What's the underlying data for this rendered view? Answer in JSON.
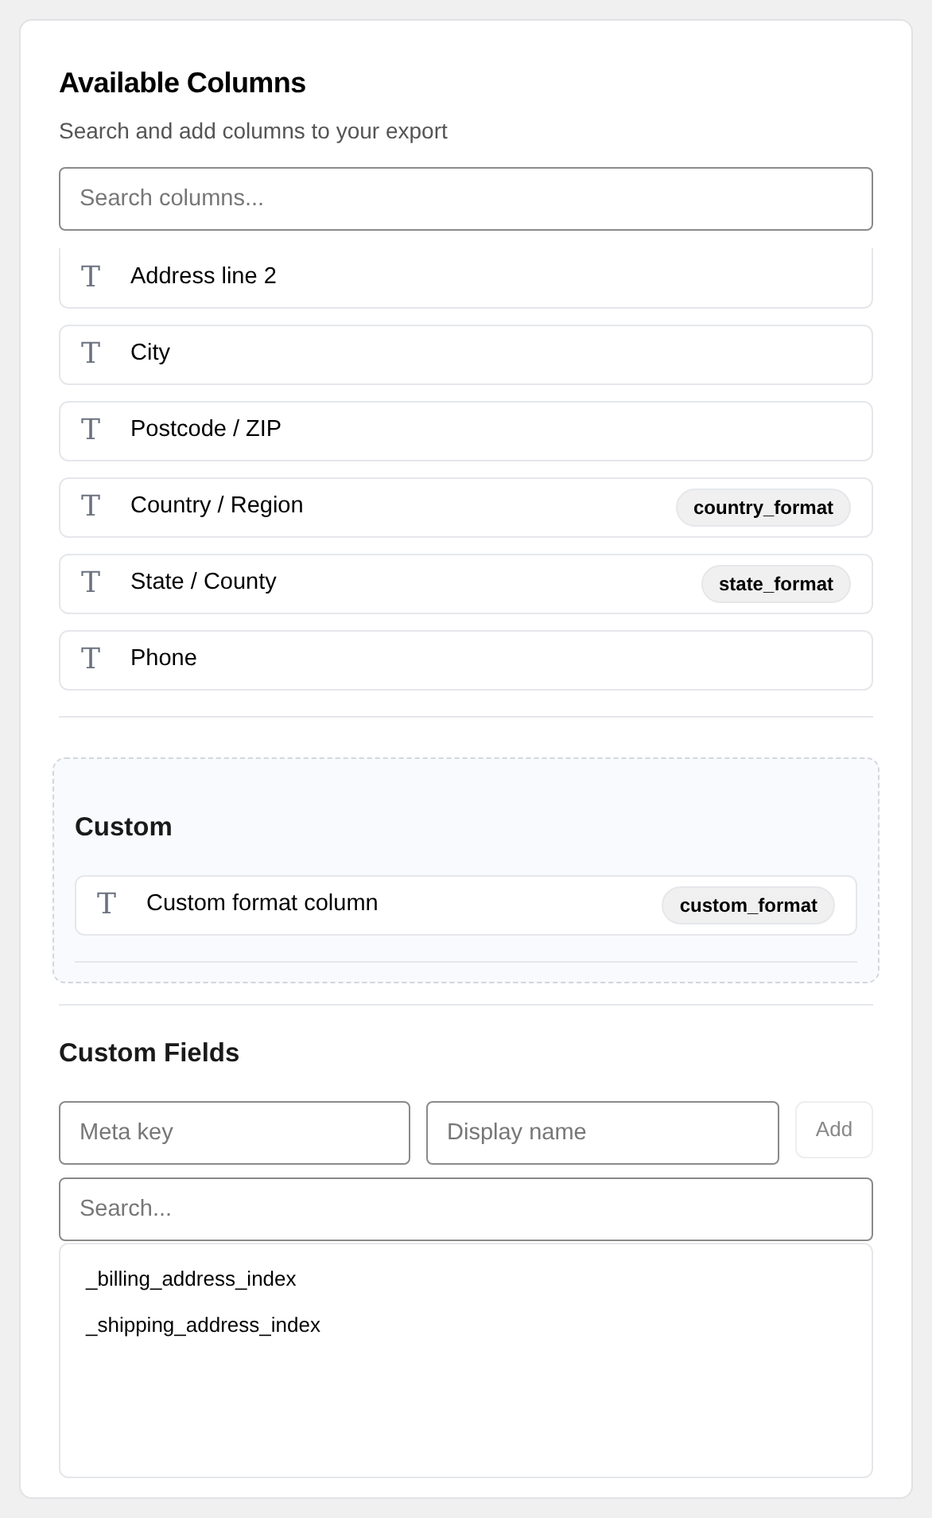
{
  "title": "Available Columns",
  "subtitle": "Search and add columns to your export",
  "search": {
    "placeholder": "Search columns..."
  },
  "columns": [
    {
      "icon": "T",
      "label": "Address line 2"
    },
    {
      "icon": "T",
      "label": "City"
    },
    {
      "icon": "T",
      "label": "Postcode / ZIP"
    },
    {
      "icon": "T",
      "label": "Country / Region",
      "badge": "country_format"
    },
    {
      "icon": "T",
      "label": "State / County",
      "badge": "state_format"
    },
    {
      "icon": "T",
      "label": "Phone"
    }
  ],
  "custom": {
    "title": "Custom",
    "columns": [
      {
        "icon": "T",
        "label": "Custom format column",
        "badge": "custom_format"
      }
    ]
  },
  "custom_fields": {
    "title": "Custom Fields",
    "meta_key": {
      "placeholder": "Meta key"
    },
    "display_name": {
      "placeholder": "Display name"
    },
    "add_button": {
      "label": "Add",
      "disabled": true
    },
    "search": {
      "placeholder": "Search..."
    },
    "items": [
      "_billing_address_index",
      "_shipping_address_index"
    ]
  }
}
